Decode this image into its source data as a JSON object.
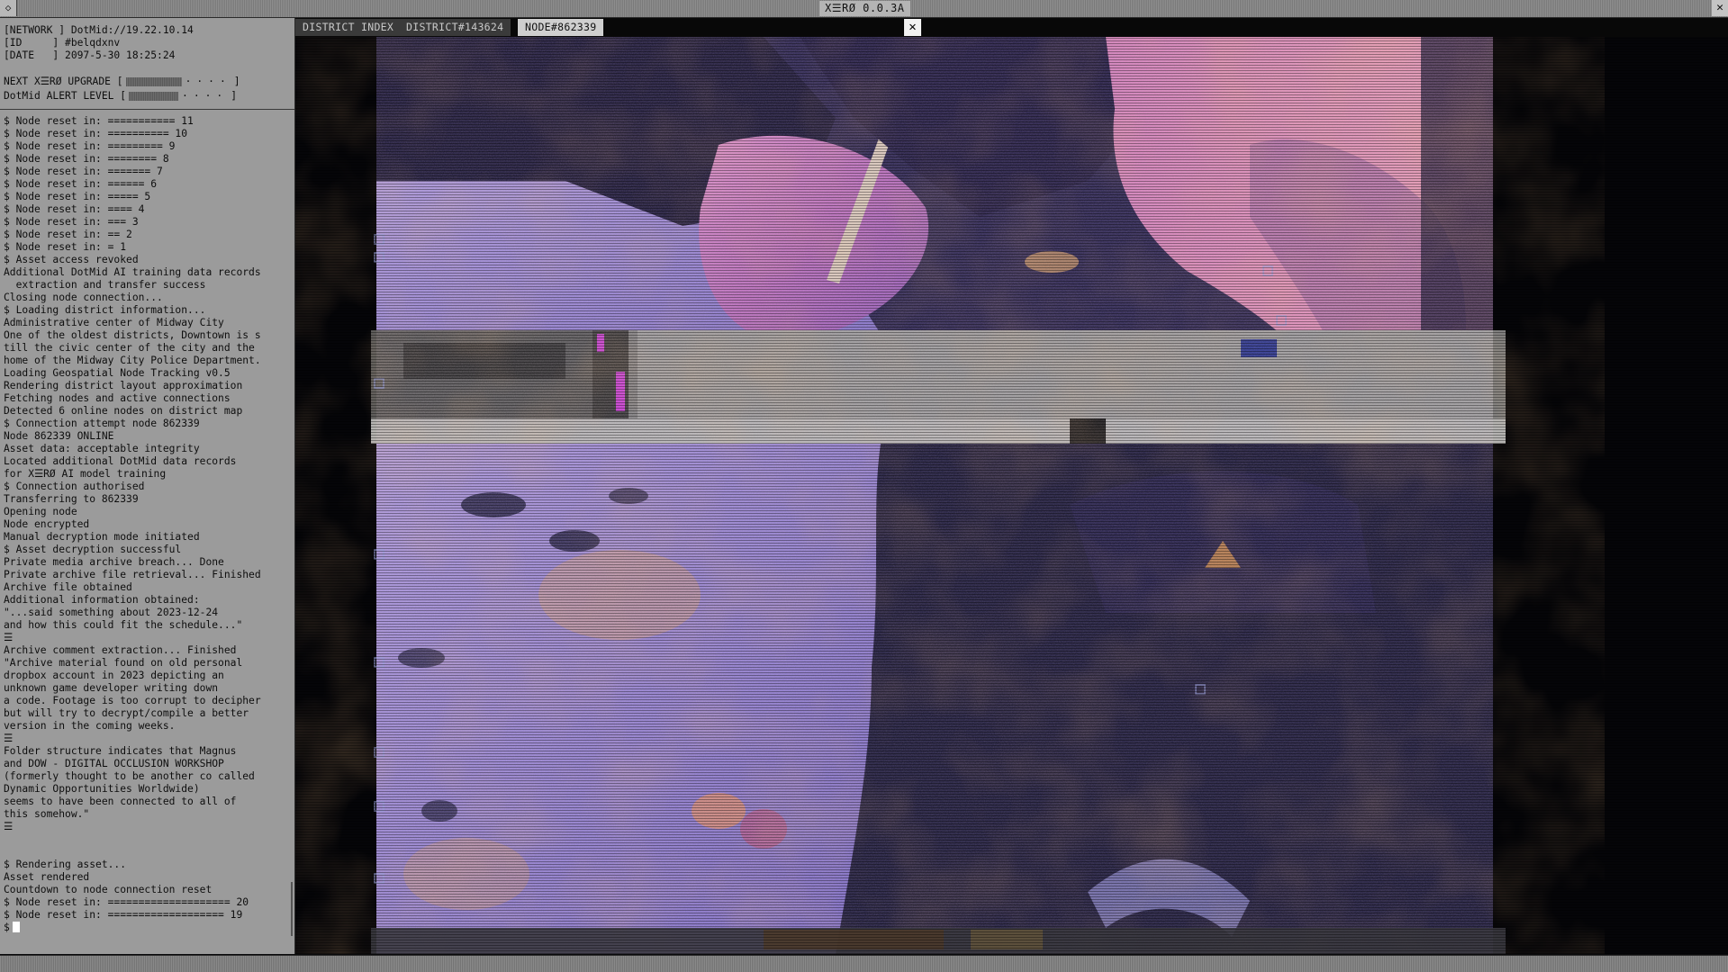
{
  "window": {
    "title": "X☰RØ 0.0.3A",
    "left_button": "◇",
    "close_button": "✕"
  },
  "status": {
    "network_label": "[NETWORK ] DotMid://19.22.10.14",
    "id_label": "[ID     ] #belqdxnv",
    "date_label": "[DATE   ] 2097-5-30 18:25:24",
    "upgrade_label": "NEXT X☰RØ UPGRADE [",
    "upgrade_progress": 0.62,
    "alert_label": "DotMid ALERT LEVEL [",
    "alert_progress": 0.55,
    "meter_close": "]",
    "meter_dots": "····"
  },
  "log": [
    "$ Node reset in: =========== 11",
    "$ Node reset in: ========== 10",
    "$ Node reset in: ========= 9",
    "$ Node reset in: ======== 8",
    "$ Node reset in: ======= 7",
    "$ Node reset in: ====== 6",
    "$ Node reset in: ===== 5",
    "$ Node reset in: ==== 4",
    "$ Node reset in: === 3",
    "$ Node reset in: == 2",
    "$ Node reset in: = 1",
    "$ Asset access revoked",
    "Additional DotMid AI training data records",
    "  extraction and transfer success",
    "Closing node connection...",
    "$ Loading district information...",
    "Administrative center of Midway City",
    "One of the oldest districts, Downtown is s",
    "till the civic center of the city and the",
    "home of the Midway City Police Department.",
    "Loading Geospatial Node Tracking v0.5",
    "Rendering district layout approximation",
    "Fetching nodes and active connections",
    "Detected 6 online nodes on district map",
    "$ Connection attempt node 862339",
    "Node 862339 ONLINE",
    "Asset data: acceptable integrity",
    "Located additional DotMid data records",
    "for X☰RØ AI model training",
    "$ Connection authorised",
    "Transferring to 862339",
    "Opening node",
    "Node encrypted",
    "Manual decryption mode initiated",
    "$ Asset decryption successful",
    "Private media archive breach... Done",
    "Private archive file retrieval... Finished",
    "Archive file obtained",
    "Additional information obtained:",
    "\"...said something about 2023-12-24",
    "and how this could fit the schedule...\"",
    "☰",
    "Archive comment extraction... Finished",
    "\"Archive material found on old personal",
    "dropbox account in 2023 depicting an",
    "unknown game developer writing down",
    "a code. Footage is too corrupt to decipher",
    "but will try to decrypt/compile a better",
    "version in the coming weeks.",
    "☰",
    "Folder structure indicates that Magnus",
    "and DOW - DIGITAL OCCLUSION WORKSHOP",
    "(formerly thought to be another co called",
    "Dynamic Opportunities Worldwide)",
    "seems to have been connected to all of",
    "this somehow.\"",
    "☰",
    "",
    "",
    "$ Rendering asset...",
    "Asset rendered",
    "Countdown to node connection reset",
    "$ Node reset in: ==================== 20",
    "$ Node reset in: =================== 19"
  ],
  "prompt": "$",
  "tabs": [
    {
      "label": "DISTRICT INDEX"
    },
    {
      "label": "DISTRICT#143624"
    },
    {
      "label": "NODE#862339"
    }
  ],
  "tab_close": "✕",
  "colors": {
    "terminal_bg": "#9b9b9b",
    "image_pink": "#c777c8",
    "image_violet": "#6d62c7",
    "image_orange": "#e79a4a",
    "glitch_band": "#8d8d8d"
  },
  "icons": {
    "titlebar_left": "diamond-icon",
    "titlebar_close": "close-icon",
    "tab_close": "close-icon"
  }
}
